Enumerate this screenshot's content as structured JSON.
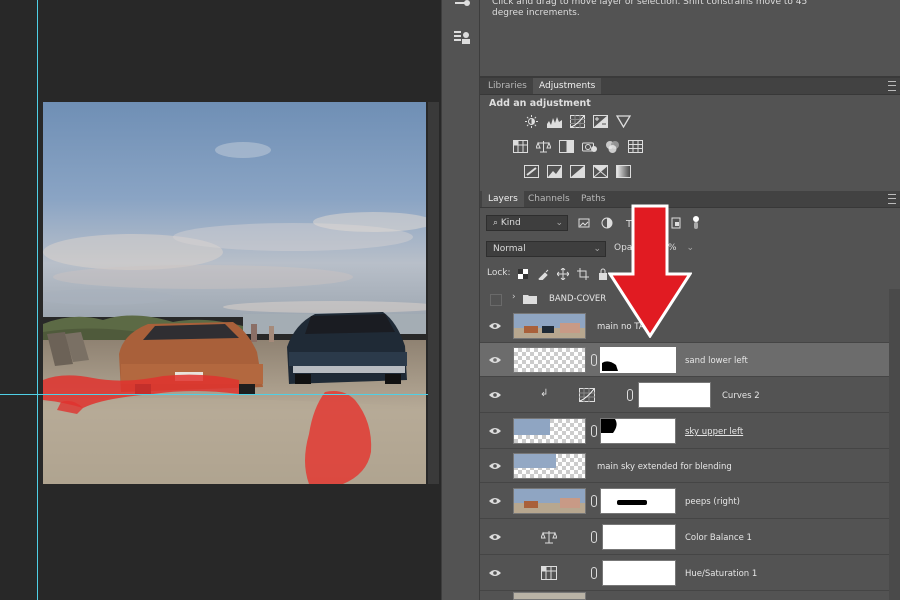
{
  "info": {
    "text": "Click and drag to move layer or selection. Shift constrains move to 45 degree increments."
  },
  "adjustments_panel": {
    "tabs": [
      "Libraries",
      "Adjustments"
    ],
    "active_tab": "Adjustments",
    "title": "Add an adjustment",
    "icons_row1": [
      "brightness-contrast-icon",
      "levels-icon",
      "curves-icon",
      "exposure-icon",
      "gradient-triangle-icon"
    ],
    "icons_row2": [
      "vibrance-icon",
      "color-balance-icon",
      "black-white-icon",
      "photo-filter-icon",
      "channel-mixer-icon",
      "color-lookup-icon"
    ],
    "icons_row3": [
      "invert-icon",
      "posterize-icon",
      "threshold-icon",
      "selective-color-icon",
      "gradient-map-icon"
    ]
  },
  "layers_panel": {
    "tabs": [
      "Layers",
      "Channels",
      "Paths"
    ],
    "active_tab": "Layers",
    "filter_label": "Kind",
    "blend_mode": "Normal",
    "opacity_label": "Opa",
    "opacity_value": "%",
    "lock_label": "Lock:",
    "group_name": "BAND-COVER",
    "layers": [
      {
        "name": "main no TA",
        "visible": true,
        "selected": false
      },
      {
        "name": "sand lower left",
        "visible": true,
        "selected": true
      },
      {
        "name": "Curves 2",
        "visible": true,
        "selected": false
      },
      {
        "name": "sky upper left",
        "visible": true,
        "selected": false
      },
      {
        "name": "main sky extended for blending",
        "visible": true,
        "selected": false
      },
      {
        "name": "peeps (right)",
        "visible": true,
        "selected": false
      },
      {
        "name": "Color Balance 1",
        "visible": true,
        "selected": false
      },
      {
        "name": "Hue/Saturation 1",
        "visible": true,
        "selected": false
      }
    ]
  },
  "colors": {
    "panel_bg": "#535353",
    "canvas_bg": "#282828",
    "guide": "#4fd0e6",
    "annotation_arrow": "#e11b22",
    "selected_row": "#6c6c6c"
  }
}
